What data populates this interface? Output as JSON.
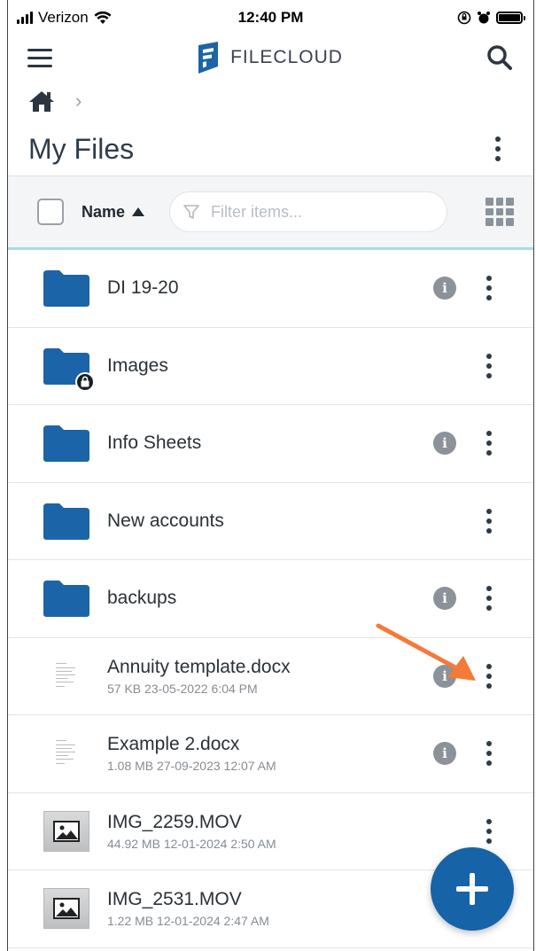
{
  "status_bar": {
    "carrier": "Verizon",
    "time": "12:40 PM"
  },
  "app": {
    "logo_text": "FILECLOUD",
    "brand_color": "#1c64a8"
  },
  "page": {
    "title": "My Files"
  },
  "toolbar": {
    "sort_label": "Name",
    "filter_placeholder": "Filter items..."
  },
  "files": [
    {
      "name": "DI 19-20",
      "meta": "",
      "type": "folder",
      "locked": false,
      "info": true
    },
    {
      "name": "Images",
      "meta": "",
      "type": "folder",
      "locked": true,
      "info": false
    },
    {
      "name": "Info Sheets",
      "meta": "",
      "type": "folder",
      "locked": false,
      "info": true
    },
    {
      "name": "New accounts",
      "meta": "",
      "type": "folder",
      "locked": false,
      "info": false
    },
    {
      "name": "backups",
      "meta": "",
      "type": "folder",
      "locked": false,
      "info": true
    },
    {
      "name": "Annuity template.docx",
      "meta": "57 KB 23-05-2022 6:04 PM",
      "type": "doc",
      "locked": false,
      "info": true
    },
    {
      "name": "Example 2.docx",
      "meta": "1.08 MB 27-09-2023 12:07 AM",
      "type": "doc",
      "locked": false,
      "info": true
    },
    {
      "name": "IMG_2259.MOV",
      "meta": "44.92 MB 12-01-2024 2:50 AM",
      "type": "image",
      "locked": false,
      "info": false
    },
    {
      "name": "IMG_2531.MOV",
      "meta": "1.22 MB 12-01-2024 2:47 AM",
      "type": "image",
      "locked": false,
      "info": false
    }
  ],
  "annotation": {
    "arrow_color": "#f47a3a"
  }
}
